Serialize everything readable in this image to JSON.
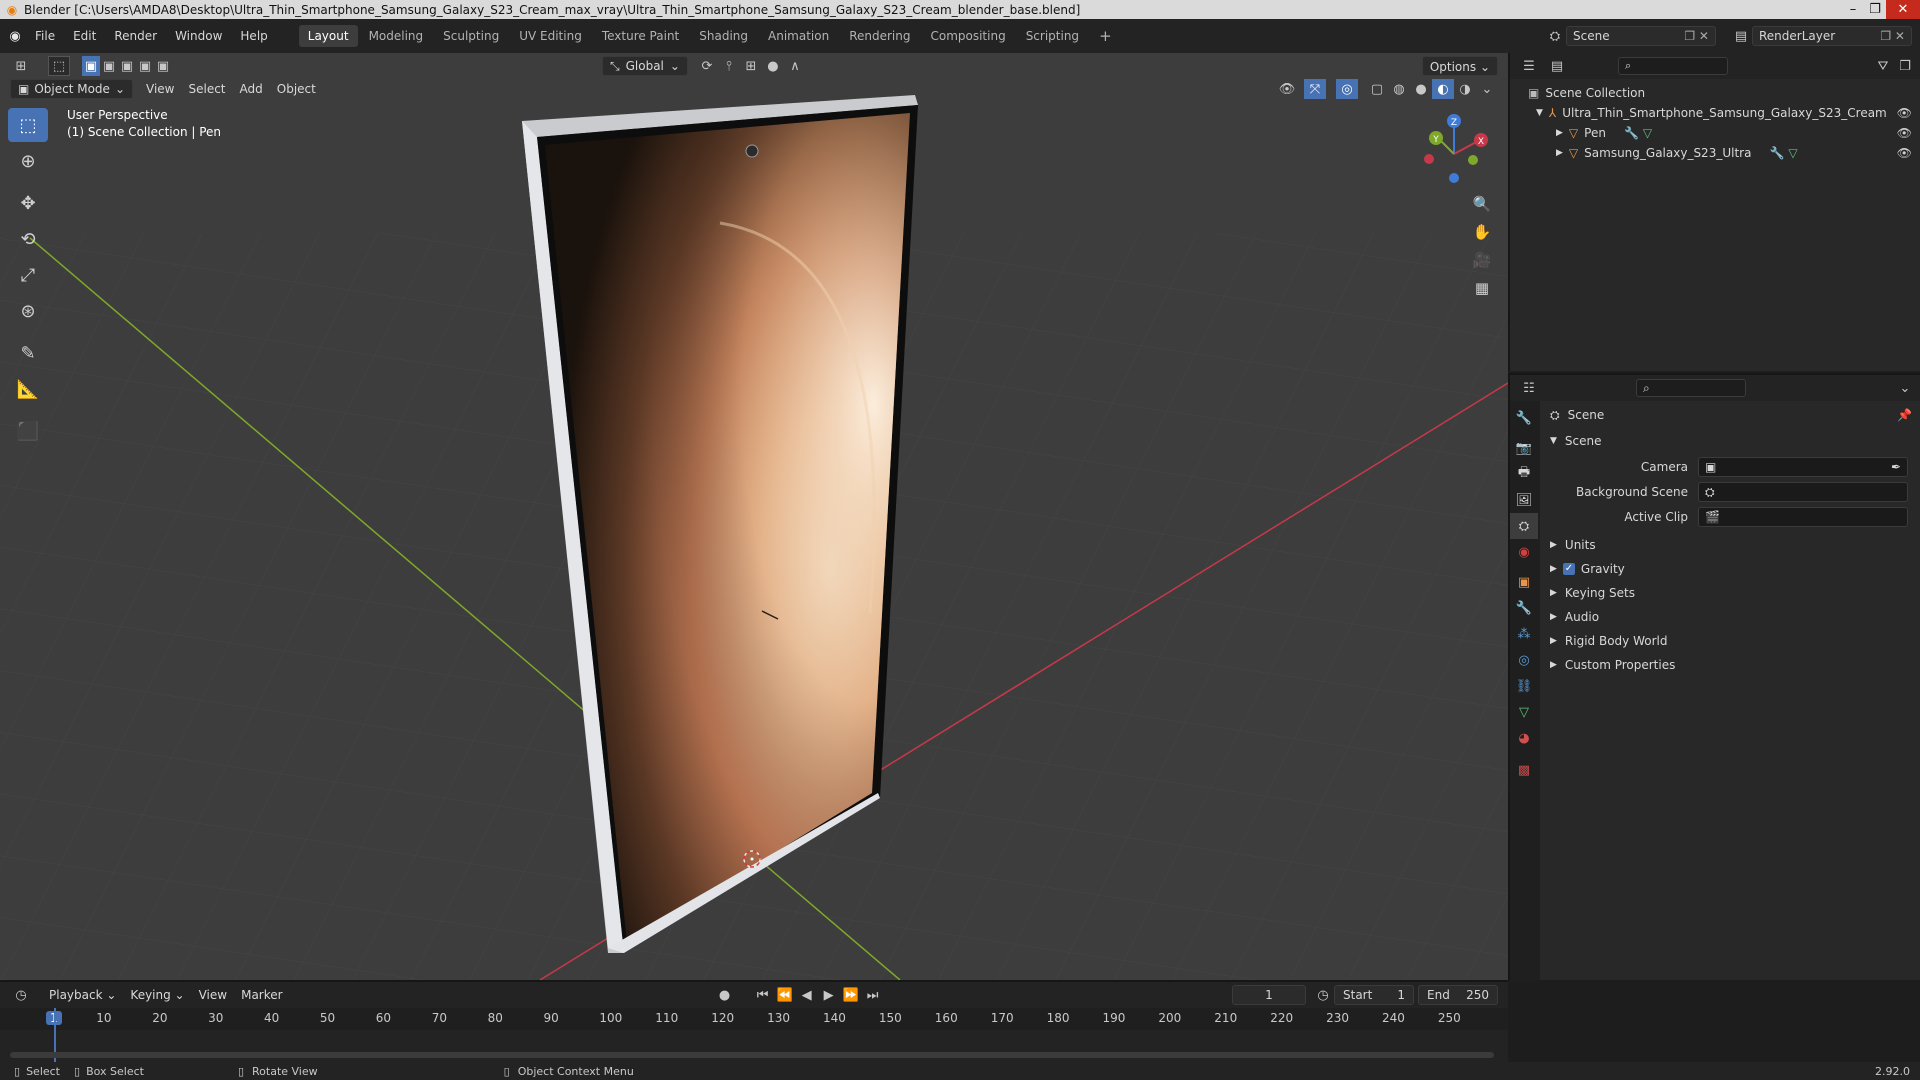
{
  "window": {
    "title": "Blender [C:\\Users\\AMDA8\\Desktop\\Ultra_Thin_Smartphone_Samsung_Galaxy_S23_Cream_max_vray\\Ultra_Thin_Smartphone_Samsung_Galaxy_S23_Cream_blender_base.blend]"
  },
  "menu": {
    "items": [
      "File",
      "Edit",
      "Render",
      "Window",
      "Help"
    ]
  },
  "workspaces": {
    "tabs": [
      "Layout",
      "Modeling",
      "Sculpting",
      "UV Editing",
      "Texture Paint",
      "Shading",
      "Animation",
      "Rendering",
      "Compositing",
      "Scripting"
    ],
    "active": "Layout"
  },
  "topbar_right": {
    "scene": "Scene",
    "view_layer": "RenderLayer"
  },
  "viewport": {
    "mode": "Object Mode",
    "menus": [
      "View",
      "Select",
      "Add",
      "Object"
    ],
    "transform_orientation": "Global",
    "options_label": "Options",
    "overlay_title": "User Perspective",
    "overlay_subtitle": "(1) Scene Collection | Pen",
    "gizmo": {
      "x": "X",
      "y": "Y",
      "z": "Z"
    }
  },
  "outliner": {
    "root": "Scene Collection",
    "collection": "Ultra_Thin_Smartphone_Samsung_Galaxy_S23_Cream",
    "objects": [
      "Pen",
      "Samsung_Galaxy_S23_Ultra"
    ]
  },
  "properties": {
    "context": "Scene",
    "panel": "Scene",
    "fields": [
      {
        "label": "Camera",
        "value": ""
      },
      {
        "label": "Background Scene",
        "value": ""
      },
      {
        "label": "Active Clip",
        "value": ""
      }
    ],
    "subpanels": [
      "Units",
      "Gravity",
      "Keying Sets",
      "Audio",
      "Rigid Body World",
      "Custom Properties"
    ],
    "gravity_checked": true
  },
  "timeline": {
    "menus": [
      "Playback",
      "Keying",
      "View",
      "Marker"
    ],
    "current_frame": "1",
    "start_label": "Start",
    "start": "1",
    "end_label": "End",
    "end": "250",
    "ticks": [
      "1",
      "10",
      "20",
      "30",
      "40",
      "50",
      "60",
      "70",
      "80",
      "90",
      "100",
      "110",
      "120",
      "130",
      "140",
      "150",
      "160",
      "170",
      "180",
      "190",
      "200",
      "210",
      "220",
      "230",
      "240",
      "250"
    ]
  },
  "statusbar": {
    "select": "Select",
    "box_select": "Box Select",
    "rotate": "Rotate View",
    "context_menu": "Object Context Menu",
    "version": "2.92.0"
  },
  "colors": {
    "accent": "#4772b3",
    "x_axis": "#c6394a",
    "y_axis": "#7fa82a",
    "viewport_bg": "#3d3d3d"
  }
}
